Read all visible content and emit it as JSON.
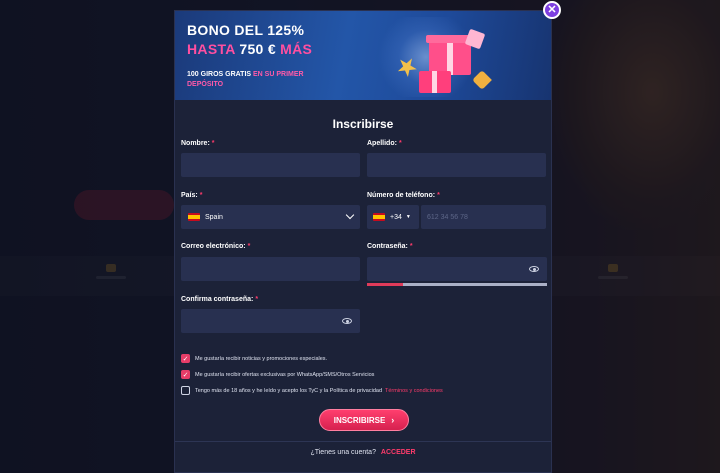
{
  "banner": {
    "line1": "BONO DEL 125%",
    "line2_prefix": "HASTA",
    "line2_amount": "750 €",
    "line2_suffix": "MÁS",
    "line3_white": "100 GIROS GRATIS",
    "line3_pink": "EN SU PRIMER DEPÓSITO"
  },
  "form": {
    "title": "Inscribirse",
    "first_name_label": "Nombre:",
    "last_name_label": "Apellido:",
    "country_label": "País:",
    "country_value": "Spain",
    "phone_label": "Número de teléfono:",
    "phone_code": "+34",
    "phone_placeholder": "612 34 56 78",
    "email_label": "Correo electrónico:",
    "password_label": "Contraseña:",
    "confirm_label": "Confirma contraseña:",
    "required_mark": "*",
    "password_strength": 0.2
  },
  "checkboxes": [
    {
      "label": "Me gustaría recibir noticias y promociones especiales.",
      "checked": true
    },
    {
      "label": "Me gustaría recibir ofertas exclusivas por WhatsApp/SMS/Otros Servicios",
      "checked": true
    },
    {
      "label": "Tengo más de 18 años y he leído y acepto los TyC y la Política de privacidad",
      "link": "Términos y condiciones",
      "checked": false
    }
  ],
  "actions": {
    "submit_label": "INSCRIBIRSE",
    "have_account": "¿Tienes una cuenta?",
    "login_label": "ACCEDER"
  },
  "colors": {
    "accent": "#ff3b6b",
    "modal_bg": "#1c2238",
    "field_bg": "#283050",
    "close_button": "#7d3fe0"
  }
}
